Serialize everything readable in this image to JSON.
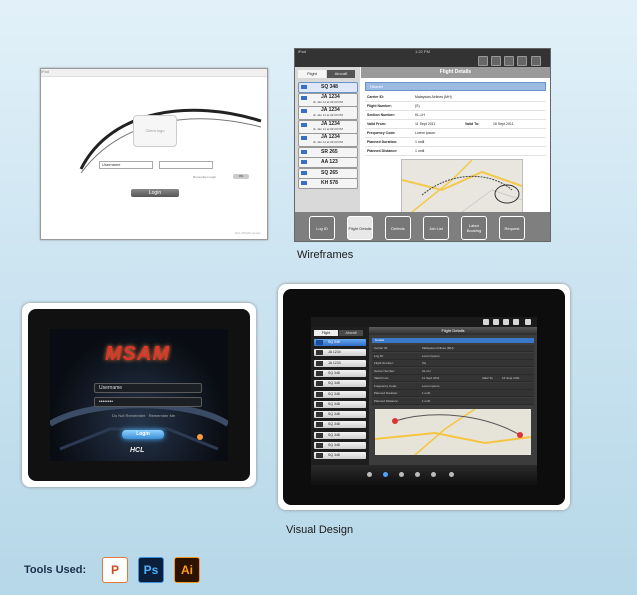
{
  "sections": {
    "wireframes_caption": "Wireframes",
    "visual_design_caption": "Visual Design",
    "tools_label": "Tools Used:"
  },
  "tools": [
    {
      "name": "ppt-icon",
      "glyph": "P"
    },
    {
      "name": "ps-icon",
      "glyph": "Ps"
    },
    {
      "name": "ai-icon",
      "glyph": "Ai"
    }
  ],
  "wf_login": {
    "status": "iPad",
    "logo_text": "Client logo",
    "username": "Username",
    "password": "",
    "remember": "Remember Login",
    "toggle": "ON",
    "login_button": "Login",
    "footer": "HCL MSAM version"
  },
  "wf_flight": {
    "status": "iPad",
    "time": "1:22 PM",
    "seg_flight": "Flight",
    "seg_aircraft": "Aircraft",
    "title": "Flight Details",
    "header": "Header",
    "flights": [
      {
        "id": "SQ 348",
        "selected": true
      },
      {
        "id": "JA 1234",
        "sub1": "dt. Jan 11 at 02:20 PM"
      },
      {
        "id": "JA 1234",
        "sub1": "dt. Jan 11 at 02:20 PM"
      },
      {
        "id": "JA 1234",
        "sub1": "dt. Jan 11 at 02:20 PM"
      },
      {
        "id": "JA 1234",
        "sub1": "dt. Jan 11 at 02:20 PM"
      },
      {
        "id": "SR 265"
      },
      {
        "id": "AA 123"
      },
      {
        "id": "SQ 265"
      },
      {
        "id": "KH 578"
      }
    ],
    "rows": [
      {
        "k": "Carrier ID:",
        "v": "Malaysian Airlines (MH)"
      },
      {
        "k": "Flight Number:",
        "v": "(S)"
      },
      {
        "k": "Section Number:",
        "v": "KL-LH"
      },
      {
        "k": "Valid From:",
        "v": "11 Sept 2011",
        "k2": "Valid To:",
        "v2": "16 Sept 2011"
      },
      {
        "k": "Frequency Code:",
        "v": "Lorem ipsum"
      },
      {
        "k": "Planned Duration:",
        "v": "1 until"
      },
      {
        "k": "Planned Distance:",
        "v": "1 until"
      }
    ],
    "tabs": [
      "Log ID",
      "Flight Details",
      "Defects",
      "Job List",
      "Labor Booking",
      "Request"
    ]
  },
  "vd_login": {
    "brand": "MSAM",
    "username": "Username",
    "password": "••••••••",
    "remember_left": "Do Not Remember",
    "remember_right": "Remember Me",
    "login_button": "Login",
    "vendor": "HCL"
  },
  "vd_flight": {
    "seg_flight": "Flight",
    "seg_aircraft": "Aircraft",
    "title": "Flight Details",
    "header": "Details",
    "flights": [
      {
        "id": "SQ 348",
        "selected": true
      },
      {
        "id": "JA 1234"
      },
      {
        "id": "JA 1234"
      },
      {
        "id": "SQ 348"
      },
      {
        "id": "SQ 348"
      },
      {
        "id": "SQ 348"
      },
      {
        "id": "SQ 348"
      },
      {
        "id": "SQ 348"
      },
      {
        "id": "SQ 348"
      },
      {
        "id": "SQ 348"
      },
      {
        "id": "SQ 348"
      },
      {
        "id": "SQ 348"
      }
    ],
    "rows": [
      {
        "k": "Carrier ID:",
        "v": "Malaysian Airlines (MH)"
      },
      {
        "k": "Log ID:",
        "v": "Lorem Ipsum"
      },
      {
        "k": "Flight Number:",
        "v": "(S)"
      },
      {
        "k": "Sector Number:",
        "v": "KL-LH"
      },
      {
        "k": "Valid From:",
        "v": "11 Sept 2011",
        "k2": "Valid To:",
        "v2": "16 Sept 2011"
      },
      {
        "k": "Frequency Code:",
        "v": "Lorem ipsum"
      },
      {
        "k": "Planned Duration:",
        "v": "1 until"
      },
      {
        "k": "Planned Distance:",
        "v": "1 until"
      }
    ]
  }
}
